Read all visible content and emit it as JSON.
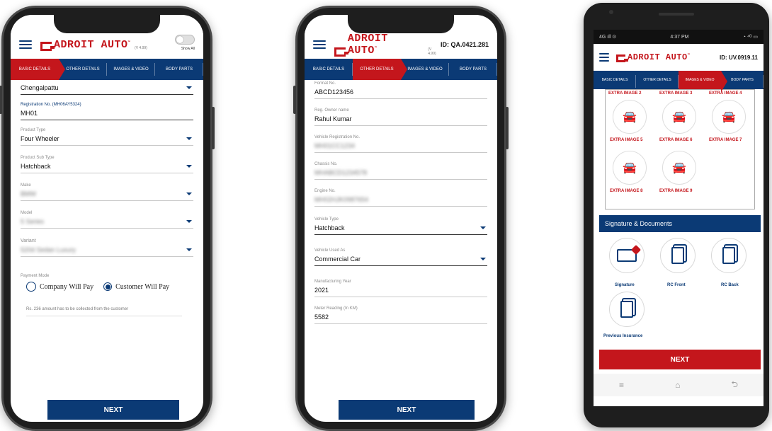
{
  "app": {
    "logo_text": "ADROIT AUTO",
    "logo_tm": "™",
    "brand_colors": {
      "primary": "#0b3a75",
      "accent": "#c4161c"
    }
  },
  "phone1": {
    "version": "(V 4.99)",
    "toggle_label": "Show All",
    "steps": [
      "BASIC DETAILS",
      "OTHER DETAILS",
      "IMAGES & VIDEO",
      "BODY PARTS"
    ],
    "active_step": 0,
    "fields": {
      "district_value": "Chengalpattu",
      "registration_label": "Registration No. (MH06AY5324)",
      "registration_value": "MH01",
      "product_type_label": "Product Type",
      "product_type_value": "Four Wheeler",
      "product_sub_type_label": "Product Sub Type",
      "product_sub_type_value": "Hatchback",
      "make_label": "Make",
      "make_value": "BMW",
      "model_label": "Model",
      "model_value": "5 Series",
      "variant_label": "Variant",
      "variant_value": "520d Sedan Luxury"
    },
    "payment": {
      "label": "Payment Mode",
      "option_company": "Company Will Pay",
      "option_customer": "Customer Will Pay",
      "selected": "Customer Will Pay"
    },
    "note": "Rs. 236 amount has to be collected from the customer",
    "next_label": "NEXT"
  },
  "phone2": {
    "version": "(V 4.99)",
    "id_text": "ID: QA.0421.281",
    "steps": [
      "BASIC DETAILS",
      "OTHER DETAILS",
      "IMAGES & VIDEO",
      "BODY PARTS"
    ],
    "active_step": 1,
    "fields": {
      "format_no_label": "Format No.",
      "format_no_value": "ABCD123456",
      "owner_label": "Reg. Owner name",
      "owner_value": "Rahul Kumar",
      "vehicle_reg_label": "Vehicle Registration No.",
      "vehicle_reg_value": "MH01CC1234",
      "chassis_label": "Chassis No.",
      "chassis_value": "MHABCD1234578",
      "engine_label": "Engine No.",
      "engine_value": "MH02HJK0987654",
      "vehicle_type_label": "Vehicle Type",
      "vehicle_type_value": "Hatchback",
      "used_as_label": "Vehicle Used As",
      "used_as_value": "Commercial Car",
      "mfg_year_label": "Manufacturing Year",
      "mfg_year_value": "2021",
      "meter_label": "Meter Reading (In KM)",
      "meter_value": "5582"
    },
    "next_label": "NEXT"
  },
  "phone3": {
    "status": {
      "left": "4G ıll ⊙",
      "time": "4:37 PM",
      "right": "◔ ⁴ᴳ ▭"
    },
    "id_text": "ID: UV.0919.11",
    "steps": [
      "BASIC DETAILS",
      "OTHER DETAILS",
      "IMAGES & VIDEO",
      "BODY PARTS"
    ],
    "active_step": 2,
    "top_labels": [
      "EXTRA IMAGE 2",
      "EXTRA IMAGE 3",
      "EXTRA IMAGE 4"
    ],
    "images": [
      "EXTRA IMAGE 5",
      "EXTRA IMAGE 6",
      "EXTRA IMAGE 7",
      "EXTRA IMAGE 8",
      "EXTRA IMAGE 9"
    ],
    "section_title": "Signature & Documents",
    "documents": [
      "Signature",
      "RC Front",
      "RC Back",
      "Previous Insurance"
    ],
    "next_label": "NEXT",
    "nav": {
      "menu": "≡",
      "home": "⌂",
      "back": "⮌"
    }
  }
}
